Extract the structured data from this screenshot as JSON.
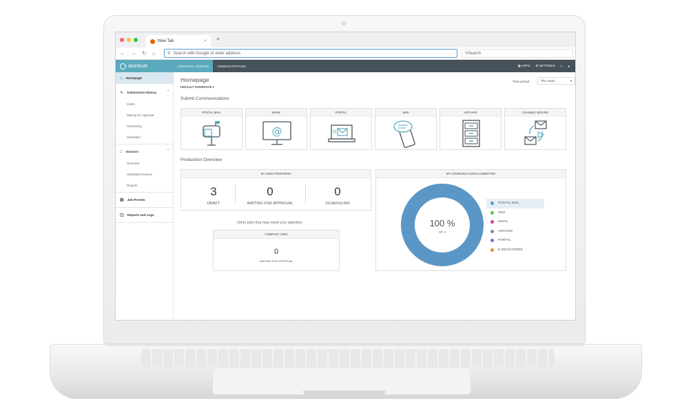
{
  "browser": {
    "tab_title": "New Tab",
    "tab_close": "×",
    "new_tab": "+",
    "address_placeholder": "Search with Google or enter address",
    "search_placeholder": "Search"
  },
  "app": {
    "brand": "distribute",
    "nav": [
      {
        "label": "CONTROL CENTER"
      },
      {
        "label": "ADMINISTRATION"
      }
    ],
    "apps_label": "APPS",
    "settings_label": "SETTINGS",
    "help_label": "?"
  },
  "sidebar": {
    "homepage": "Homepage",
    "submission_history": "Submission History",
    "submission_items": [
      {
        "label": "Drafts"
      },
      {
        "label": "Waiting for Approval"
      },
      {
        "label": "Scheduling"
      },
      {
        "label": "Submitted"
      }
    ],
    "invoices": "Invoices",
    "invoice_items": [
      {
        "label": "Overview"
      },
      {
        "label": "Submitted invoices"
      },
      {
        "label": "Reports"
      }
    ],
    "job_presets": "Job Presets",
    "reports_logs": "Reports and Logs"
  },
  "main": {
    "title": "Homepage",
    "homepage_select": "DEFAULT HOMEPAGE",
    "time_period_label": "Time period:",
    "time_period_value": "This week",
    "submit_title": "Submit Communications",
    "cards": [
      {
        "label": "POSTAL MAIL",
        "icon": "mailbox-icon"
      },
      {
        "label": "EMAIL",
        "icon": "email-monitor-icon"
      },
      {
        "label": "PORTAL",
        "icon": "portal-laptop-icon"
      },
      {
        "label": "SMS",
        "icon": "sms-phone-icon"
      },
      {
        "label": "ARCHIVE",
        "icon": "archive-cabinet-icon"
      },
      {
        "label": "CHANNEL WIZARD",
        "icon": "channel-wizard-icon"
      }
    ],
    "production_title": "Production Overview",
    "jobs_preparing": {
      "title": "MY JOBS PREPARING",
      "stats": [
        {
          "value": "3",
          "label": "DRAFT"
        },
        {
          "value": "0",
          "label": "WAITING FOR APPROVAL"
        },
        {
          "value": "0",
          "label": "SCHEDULING"
        }
      ]
    },
    "attention_text": "Other jobs that may need your attention",
    "company_jobs": {
      "title": "COMPANY JOBS",
      "value": "0",
      "label": "WAITING FOR APPROVAL"
    },
    "communications": {
      "title": "MY COMMUNICATIONS SUBMITTED",
      "percent": "100 %",
      "of": "OF 2",
      "share": 1.0,
      "ring_color": "#5b97c6",
      "legend": [
        {
          "label": "POSTAL MAIL",
          "color": "#5b97c6"
        },
        {
          "label": "SMS",
          "color": "#6cc04a"
        },
        {
          "label": "EMAIL",
          "color": "#d63a9c"
        },
        {
          "label": "ARCHIVE",
          "color": "#8a8a8a"
        },
        {
          "label": "PORTAL",
          "color": "#7a6fc4"
        },
        {
          "label": "E-REGISTERED",
          "color": "#e58a2a"
        }
      ]
    }
  }
}
